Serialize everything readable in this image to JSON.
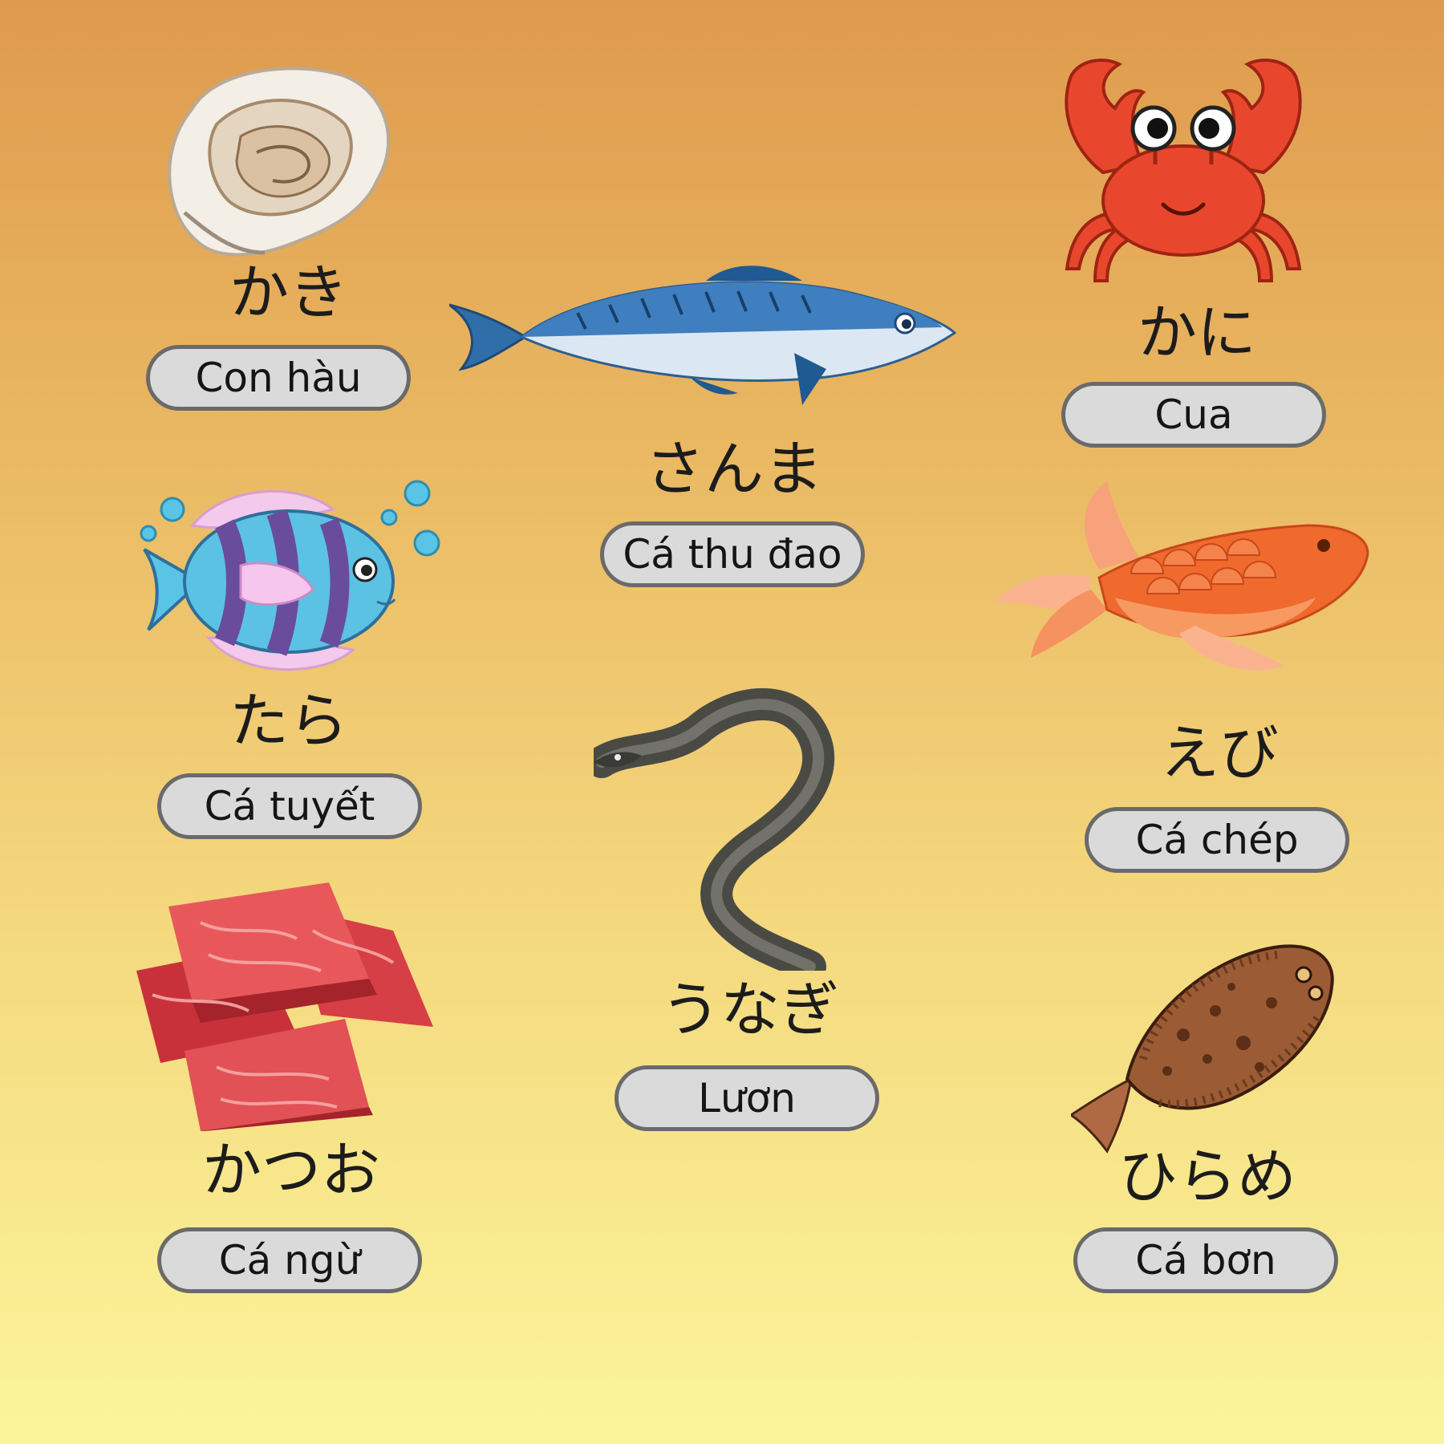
{
  "items": [
    {
      "id": "oyster",
      "icon": "oyster-icon",
      "jp": "かき",
      "vi": "Con hàu"
    },
    {
      "id": "cod",
      "icon": "cod-fish-icon",
      "jp": "たら",
      "vi": "Cá tuyết"
    },
    {
      "id": "tuna",
      "icon": "tuna-slices-icon",
      "jp": "かつお",
      "vi": "Cá ngừ"
    },
    {
      "id": "saury",
      "icon": "saury-fish-icon",
      "jp": "さんま",
      "vi": "Cá thu đao"
    },
    {
      "id": "eel",
      "icon": "eel-icon",
      "jp": "うなぎ",
      "vi": "Lươn"
    },
    {
      "id": "crab",
      "icon": "crab-icon",
      "jp": "かに",
      "vi": "Cua"
    },
    {
      "id": "carp",
      "icon": "carp-fish-icon",
      "jp": "えび",
      "vi": "Cá chép"
    },
    {
      "id": "flounder",
      "icon": "flounder-icon",
      "jp": "ひらめ",
      "vi": "Cá bơn"
    }
  ],
  "colors": {
    "pill_fill": "#dadada",
    "pill_border": "#6a6a6a",
    "crab": "#e9472d",
    "carp": "#ef6a2c",
    "saury": "#3f7fbf",
    "tuna": "#d83a3e"
  }
}
